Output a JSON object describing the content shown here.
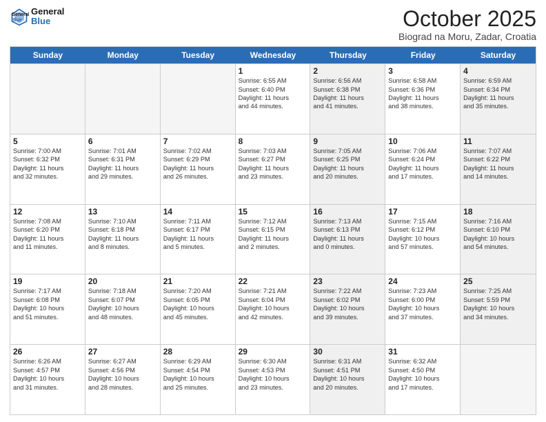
{
  "header": {
    "logo_line1": "General",
    "logo_line2": "Blue",
    "title": "October 2025",
    "subtitle": "Biograd na Moru, Zadar, Croatia"
  },
  "weekdays": [
    "Sunday",
    "Monday",
    "Tuesday",
    "Wednesday",
    "Thursday",
    "Friday",
    "Saturday"
  ],
  "rows": [
    [
      {
        "day": "",
        "info": "",
        "shaded": false,
        "empty": true
      },
      {
        "day": "",
        "info": "",
        "shaded": false,
        "empty": true
      },
      {
        "day": "",
        "info": "",
        "shaded": false,
        "empty": true
      },
      {
        "day": "1",
        "info": "Sunrise: 6:55 AM\nSunset: 6:40 PM\nDaylight: 11 hours\nand 44 minutes.",
        "shaded": false,
        "empty": false
      },
      {
        "day": "2",
        "info": "Sunrise: 6:56 AM\nSunset: 6:38 PM\nDaylight: 11 hours\nand 41 minutes.",
        "shaded": true,
        "empty": false
      },
      {
        "day": "3",
        "info": "Sunrise: 6:58 AM\nSunset: 6:36 PM\nDaylight: 11 hours\nand 38 minutes.",
        "shaded": false,
        "empty": false
      },
      {
        "day": "4",
        "info": "Sunrise: 6:59 AM\nSunset: 6:34 PM\nDaylight: 11 hours\nand 35 minutes.",
        "shaded": true,
        "empty": false
      }
    ],
    [
      {
        "day": "5",
        "info": "Sunrise: 7:00 AM\nSunset: 6:32 PM\nDaylight: 11 hours\nand 32 minutes.",
        "shaded": false,
        "empty": false
      },
      {
        "day": "6",
        "info": "Sunrise: 7:01 AM\nSunset: 6:31 PM\nDaylight: 11 hours\nand 29 minutes.",
        "shaded": false,
        "empty": false
      },
      {
        "day": "7",
        "info": "Sunrise: 7:02 AM\nSunset: 6:29 PM\nDaylight: 11 hours\nand 26 minutes.",
        "shaded": false,
        "empty": false
      },
      {
        "day": "8",
        "info": "Sunrise: 7:03 AM\nSunset: 6:27 PM\nDaylight: 11 hours\nand 23 minutes.",
        "shaded": false,
        "empty": false
      },
      {
        "day": "9",
        "info": "Sunrise: 7:05 AM\nSunset: 6:25 PM\nDaylight: 11 hours\nand 20 minutes.",
        "shaded": true,
        "empty": false
      },
      {
        "day": "10",
        "info": "Sunrise: 7:06 AM\nSunset: 6:24 PM\nDaylight: 11 hours\nand 17 minutes.",
        "shaded": false,
        "empty": false
      },
      {
        "day": "11",
        "info": "Sunrise: 7:07 AM\nSunset: 6:22 PM\nDaylight: 11 hours\nand 14 minutes.",
        "shaded": true,
        "empty": false
      }
    ],
    [
      {
        "day": "12",
        "info": "Sunrise: 7:08 AM\nSunset: 6:20 PM\nDaylight: 11 hours\nand 11 minutes.",
        "shaded": false,
        "empty": false
      },
      {
        "day": "13",
        "info": "Sunrise: 7:10 AM\nSunset: 6:18 PM\nDaylight: 11 hours\nand 8 minutes.",
        "shaded": false,
        "empty": false
      },
      {
        "day": "14",
        "info": "Sunrise: 7:11 AM\nSunset: 6:17 PM\nDaylight: 11 hours\nand 5 minutes.",
        "shaded": false,
        "empty": false
      },
      {
        "day": "15",
        "info": "Sunrise: 7:12 AM\nSunset: 6:15 PM\nDaylight: 11 hours\nand 2 minutes.",
        "shaded": false,
        "empty": false
      },
      {
        "day": "16",
        "info": "Sunrise: 7:13 AM\nSunset: 6:13 PM\nDaylight: 11 hours\nand 0 minutes.",
        "shaded": true,
        "empty": false
      },
      {
        "day": "17",
        "info": "Sunrise: 7:15 AM\nSunset: 6:12 PM\nDaylight: 10 hours\nand 57 minutes.",
        "shaded": false,
        "empty": false
      },
      {
        "day": "18",
        "info": "Sunrise: 7:16 AM\nSunset: 6:10 PM\nDaylight: 10 hours\nand 54 minutes.",
        "shaded": true,
        "empty": false
      }
    ],
    [
      {
        "day": "19",
        "info": "Sunrise: 7:17 AM\nSunset: 6:08 PM\nDaylight: 10 hours\nand 51 minutes.",
        "shaded": false,
        "empty": false
      },
      {
        "day": "20",
        "info": "Sunrise: 7:18 AM\nSunset: 6:07 PM\nDaylight: 10 hours\nand 48 minutes.",
        "shaded": false,
        "empty": false
      },
      {
        "day": "21",
        "info": "Sunrise: 7:20 AM\nSunset: 6:05 PM\nDaylight: 10 hours\nand 45 minutes.",
        "shaded": false,
        "empty": false
      },
      {
        "day": "22",
        "info": "Sunrise: 7:21 AM\nSunset: 6:04 PM\nDaylight: 10 hours\nand 42 minutes.",
        "shaded": false,
        "empty": false
      },
      {
        "day": "23",
        "info": "Sunrise: 7:22 AM\nSunset: 6:02 PM\nDaylight: 10 hours\nand 39 minutes.",
        "shaded": true,
        "empty": false
      },
      {
        "day": "24",
        "info": "Sunrise: 7:23 AM\nSunset: 6:00 PM\nDaylight: 10 hours\nand 37 minutes.",
        "shaded": false,
        "empty": false
      },
      {
        "day": "25",
        "info": "Sunrise: 7:25 AM\nSunset: 5:59 PM\nDaylight: 10 hours\nand 34 minutes.",
        "shaded": true,
        "empty": false
      }
    ],
    [
      {
        "day": "26",
        "info": "Sunrise: 6:26 AM\nSunset: 4:57 PM\nDaylight: 10 hours\nand 31 minutes.",
        "shaded": false,
        "empty": false
      },
      {
        "day": "27",
        "info": "Sunrise: 6:27 AM\nSunset: 4:56 PM\nDaylight: 10 hours\nand 28 minutes.",
        "shaded": false,
        "empty": false
      },
      {
        "day": "28",
        "info": "Sunrise: 6:29 AM\nSunset: 4:54 PM\nDaylight: 10 hours\nand 25 minutes.",
        "shaded": false,
        "empty": false
      },
      {
        "day": "29",
        "info": "Sunrise: 6:30 AM\nSunset: 4:53 PM\nDaylight: 10 hours\nand 23 minutes.",
        "shaded": false,
        "empty": false
      },
      {
        "day": "30",
        "info": "Sunrise: 6:31 AM\nSunset: 4:51 PM\nDaylight: 10 hours\nand 20 minutes.",
        "shaded": true,
        "empty": false
      },
      {
        "day": "31",
        "info": "Sunrise: 6:32 AM\nSunset: 4:50 PM\nDaylight: 10 hours\nand 17 minutes.",
        "shaded": false,
        "empty": false
      },
      {
        "day": "",
        "info": "",
        "shaded": true,
        "empty": true
      }
    ]
  ]
}
